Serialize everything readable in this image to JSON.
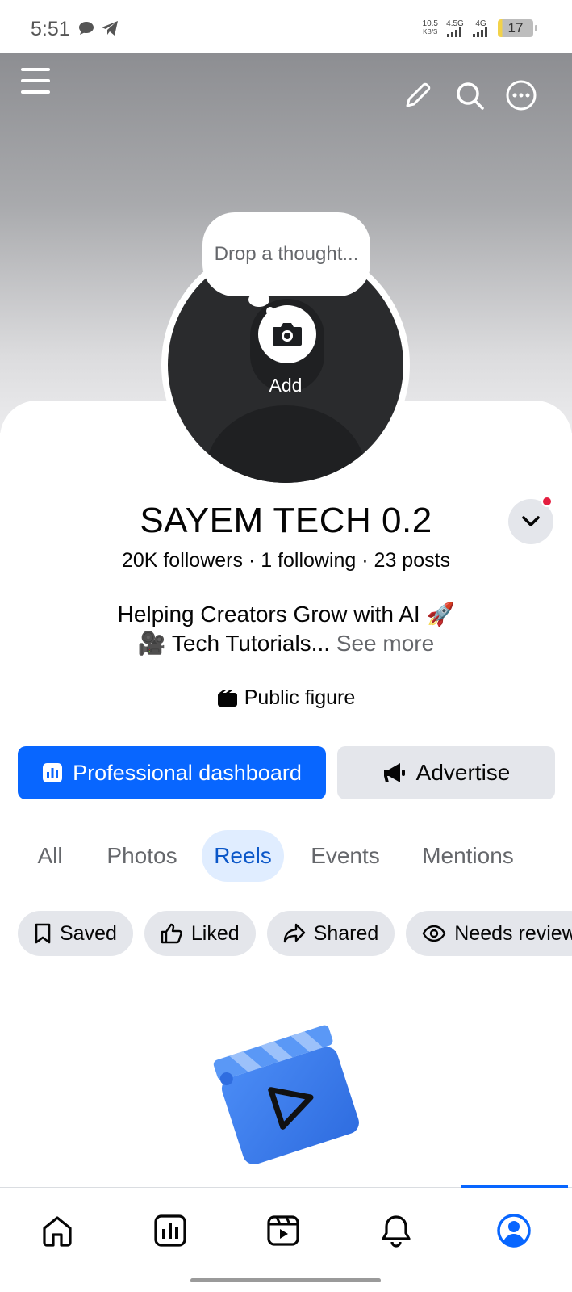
{
  "status_bar": {
    "time": "5:51",
    "net_speed_value": "10.5",
    "net_speed_unit": "KB/S",
    "signal1_label": "4.5G",
    "signal2_label": "4G",
    "battery": "17"
  },
  "cover": {
    "menu_icon": "hamburger-icon",
    "edit_icon": "pencil-icon",
    "search_icon": "search-icon",
    "more_icon": "more-icon",
    "camera_icon": "camera-icon"
  },
  "profile": {
    "thought_placeholder": "Drop a thought...",
    "add_label": "Add",
    "name": "SAYEM TECH 0.2",
    "stats": "20K followers · 1 following · 23 posts",
    "bio_line1": "Helping Creators Grow with AI 🚀",
    "bio_line2": "🎥 Tech Tutorials...",
    "see_more": "See more",
    "category": "Public figure"
  },
  "actions": {
    "dashboard_label": "Professional dashboard",
    "advertise_label": "Advertise"
  },
  "tabs": [
    {
      "label": "All",
      "active": false
    },
    {
      "label": "Photos",
      "active": false
    },
    {
      "label": "Reels",
      "active": true
    },
    {
      "label": "Events",
      "active": false
    },
    {
      "label": "Mentions",
      "active": false
    }
  ],
  "chips": [
    {
      "label": "Saved",
      "icon": "bookmark-icon"
    },
    {
      "label": "Liked",
      "icon": "thumbs-up-icon"
    },
    {
      "label": "Shared",
      "icon": "share-icon"
    },
    {
      "label": "Needs review",
      "icon": "eye-icon"
    }
  ],
  "bottom_nav": [
    {
      "name": "home",
      "icon": "home-icon",
      "active": false
    },
    {
      "name": "dashboard",
      "icon": "dashboard-icon",
      "active": false
    },
    {
      "name": "video",
      "icon": "video-icon",
      "active": false
    },
    {
      "name": "notifications",
      "icon": "bell-icon",
      "active": false
    },
    {
      "name": "profile",
      "icon": "profile-icon",
      "active": true
    }
  ],
  "colors": {
    "accent": "#0866ff",
    "active_tab_bg": "#e0edff",
    "active_tab_text": "#0b57c8",
    "notification_dot": "#e41e3f"
  }
}
